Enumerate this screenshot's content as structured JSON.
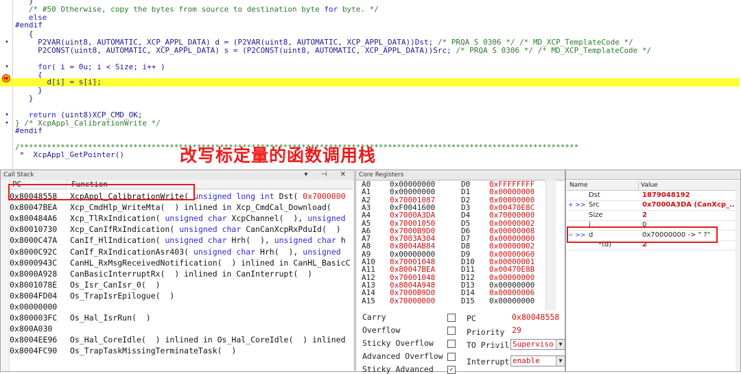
{
  "editor": {
    "lines": [
      {
        "gutter": "",
        "text": "   }"
      },
      {
        "gutter": "",
        "text": "   /* #50 Otherwise, copy the bytes from source to destination byte for byte. */"
      },
      {
        "gutter": "",
        "text": "   else"
      },
      {
        "gutter": "",
        "text": "#endif"
      },
      {
        "gutter": "",
        "text": "   {"
      },
      {
        "gutter": "•",
        "text": "     P2VAR(uint8, AUTOMATIC, XCP_APPL_DATA) d = (P2VAR(uint8, AUTOMATIC, XCP_APPL_DATA))Dst; /* PRQA S 0306 */ /* MD_XCP_TemplateCode */"
      },
      {
        "gutter": "",
        "text": "     P2CONST(uint8, AUTOMATIC, XCP_APPL_DATA) s = (P2CONST(uint8, AUTOMATIC, XCP_APPL_DATA))Src; /* PRQA S 0306 */ /* MD_XCP_TemplateCode */"
      },
      {
        "gutter": "",
        "text": ""
      },
      {
        "gutter": "•",
        "text": "     for( i = 0u; i < Size; i++ )"
      },
      {
        "gutter": "",
        "text": "     {"
      },
      {
        "gutter": "",
        "text": "       d[i] = s[i];"
      },
      {
        "gutter": "",
        "text": "     }"
      },
      {
        "gutter": "",
        "text": "   }"
      },
      {
        "gutter": "",
        "text": ""
      },
      {
        "gutter": "•",
        "text": "   return (uint8)XCP_CMD_OK;"
      },
      {
        "gutter": "•",
        "text": "} /* XcpAppl_CalibrationWrite */"
      },
      {
        "gutter": "",
        "text": "#endif"
      },
      {
        "gutter": "",
        "text": ""
      },
      {
        "gutter": "",
        "text": "/***************************************************************************************************************************"
      },
      {
        "gutter": "",
        "text": " *  XcpAppl_GetPointer()"
      }
    ],
    "annotation": "改写标定量的函数调用栈"
  },
  "call_stack": {
    "title": "Call Stack",
    "col_pc": "PC",
    "col_function": "Function",
    "rows": [
      {
        "pc": "0x80048558",
        "fn": "XcpAppl_CalibrationWrite( unsigned long int Dst( 0x7000000"
      },
      {
        "pc": "0x80047BEA",
        "fn": "Xcp_CmdHlp_WriteMta(  ) inlined in Xcp_CmdCal_Download("
      },
      {
        "pc": "0x800484A6",
        "fn": "Xcp_TlRxIndication( unsigned char XcpChannel(  ), unsigned"
      },
      {
        "pc": "0x80010730",
        "fn": "Xcp_CanIfRxIndication( unsigned char CanCanXcpRxPduId(  )"
      },
      {
        "pc": "0x8000C47A",
        "fn": "CanIf_HlIndication( unsigned char Hrh(  ), unsigned char h"
      },
      {
        "pc": "0x8000C92C",
        "fn": "CanIf_RxIndicationAsr403( unsigned char Hrh(  ), unsigned"
      },
      {
        "pc": "0x8000943C",
        "fn": "CanHL_RxMsgReceivedNotification(  ) inlined in CanHL_BasicC"
      },
      {
        "pc": "0x8000A928",
        "fn": "CanBasicInterruptRx(  ) inlined in CanInterrupt(  )"
      },
      {
        "pc": "0x8001078E",
        "fn": "Os_Isr_CanIsr_0(  )"
      },
      {
        "pc": "0x8004FD04",
        "fn": "Os_TrapIsrEpilogue(  )"
      },
      {
        "pc": "0x00000000",
        "fn": ""
      },
      {
        "pc": "0x800003FC",
        "fn": "Os_Hal_IsrRun(  )"
      },
      {
        "pc": "0x800A030",
        "fn": ""
      },
      {
        "pc": "0x8004EE96",
        "fn": "Os_Hal_CoreIdle(  ) inlined in Os_Hal_CoreIdle(  ) inlined"
      },
      {
        "pc": "0x8004FC90",
        "fn": "Os_TrapTaskMissingTerminateTask(  )"
      }
    ]
  },
  "registers": {
    "title": "Core Registers",
    "a": [
      {
        "name": "A0",
        "value": "0x00000000",
        "changed": false
      },
      {
        "name": "A1",
        "value": "0x00000000",
        "changed": false
      },
      {
        "name": "A2",
        "value": "0x70001087",
        "changed": true
      },
      {
        "name": "A3",
        "value": "0xF0041600",
        "changed": false
      },
      {
        "name": "A4",
        "value": "0x7000A3DA",
        "changed": true
      },
      {
        "name": "A5",
        "value": "0x70001050",
        "changed": true
      },
      {
        "name": "A6",
        "value": "0x7000B9D0",
        "changed": true
      },
      {
        "name": "A7",
        "value": "0x7003A304",
        "changed": true
      },
      {
        "name": "A8",
        "value": "0x8004AB84",
        "changed": true
      },
      {
        "name": "A9",
        "value": "0x00000000",
        "changed": false
      },
      {
        "name": "A10",
        "value": "0x70001048",
        "changed": true
      },
      {
        "name": "A11",
        "value": "0x80047BEA",
        "changed": true
      },
      {
        "name": "A12",
        "value": "0x70001048",
        "changed": true
      },
      {
        "name": "A13",
        "value": "0x8004A948",
        "changed": true
      },
      {
        "name": "A14",
        "value": "0x7000B9D0",
        "changed": true
      },
      {
        "name": "A15",
        "value": "0x70000000",
        "changed": true
      }
    ],
    "d": [
      {
        "name": "D0",
        "value": "0xFFFFFFFF",
        "changed": true
      },
      {
        "name": "D1",
        "value": "0x00000000",
        "changed": true
      },
      {
        "name": "D2",
        "value": "0x00000000",
        "changed": true
      },
      {
        "name": "D3",
        "value": "0x00470E8C",
        "changed": true
      },
      {
        "name": "D4",
        "value": "0x70000000",
        "changed": true
      },
      {
        "name": "D5",
        "value": "0x00000002",
        "changed": true
      },
      {
        "name": "D6",
        "value": "0x00000008",
        "changed": true
      },
      {
        "name": "D7",
        "value": "0x00000000",
        "changed": true
      },
      {
        "name": "D8",
        "value": "0x00000002",
        "changed": true
      },
      {
        "name": "D9",
        "value": "0x00000060",
        "changed": true
      },
      {
        "name": "D10",
        "value": "0x00000001",
        "changed": true
      },
      {
        "name": "D11",
        "value": "0x00470E8B",
        "changed": true
      },
      {
        "name": "D12",
        "value": "0x00000000",
        "changed": true
      },
      {
        "name": "D13",
        "value": "0x00000000",
        "changed": false
      },
      {
        "name": "D14",
        "value": "0x00000006",
        "changed": true
      },
      {
        "name": "D15",
        "value": "0x00000000",
        "changed": false
      }
    ],
    "flags": [
      "Carry",
      "Overflow",
      "Sticky Overflow",
      "Advanced Overflow",
      "Sticky Advanced"
    ],
    "pc_label": "PC",
    "pc_value": "0x80048558",
    "priority_label": "Priority",
    "priority_value": "29",
    "to_privil_label": "TO Privil",
    "to_privil_value": "Superviso",
    "interrupt_label": "Interrupt",
    "interrupt_value": "enable"
  },
  "watch": {
    "col_name": "Name",
    "col_value": "Value",
    "rows": [
      {
        "expander": "",
        "name": "Dst",
        "value": "1879048192",
        "red": true
      },
      {
        "expander": "+ >>",
        "name": "Src",
        "value": "0x7000A3DA (CanXcp_...",
        "red": true
      },
      {
        "expander": "",
        "name": "Size",
        "value": "2",
        "red": true
      },
      {
        "expander": "",
        "name": "i",
        "value": "0",
        "red": false
      },
      {
        "expander": "− >>",
        "name": "d",
        "value": "0x70000000 -> \" ?\"",
        "red": false
      },
      {
        "expander": "",
        "name": "*(d)",
        "value": "2",
        "red": true
      }
    ]
  },
  "colors": {
    "highlight": "#ffff33",
    "annotation": "#ee1c1c",
    "changed_value": "#d01010",
    "type_keyword": "#2a2ae0"
  }
}
